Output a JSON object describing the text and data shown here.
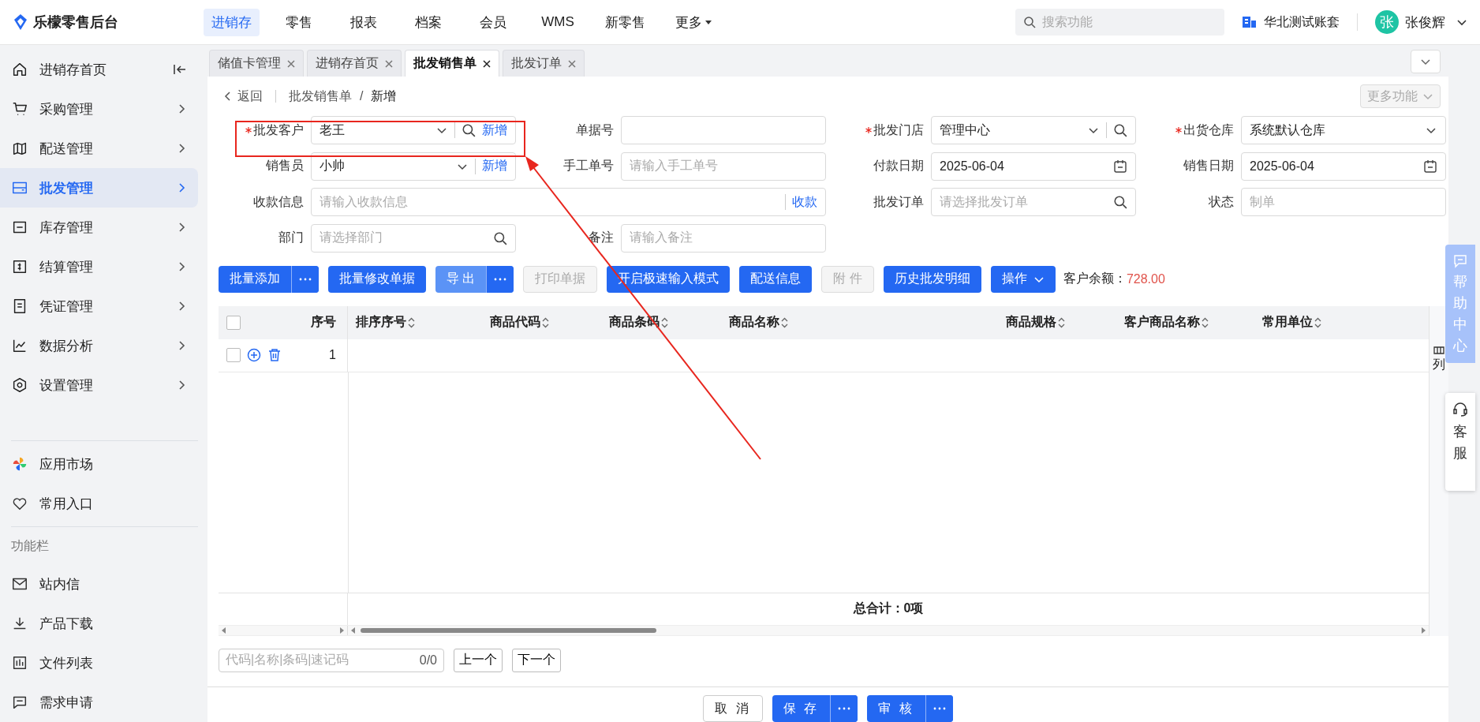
{
  "header": {
    "logo": "乐檬零售后台",
    "nav": [
      {
        "label": "进销存",
        "selected": true
      },
      {
        "label": "零售",
        "selected": false
      },
      {
        "label": "报表",
        "selected": false
      },
      {
        "label": "档案",
        "selected": false
      },
      {
        "label": "会员",
        "selected": false
      },
      {
        "label": "WMS",
        "selected": false
      },
      {
        "label": "新零售",
        "selected": false
      }
    ],
    "more": "更多",
    "search": {
      "placeholder": "搜索功能"
    },
    "account": "华北测试账套",
    "avatar": "张",
    "user": "张俊辉"
  },
  "sidebar": {
    "items": [
      {
        "label": "进销存首页",
        "selected": false
      },
      {
        "label": "采购管理",
        "selected": false
      },
      {
        "label": "配送管理",
        "selected": false
      },
      {
        "label": "批发管理",
        "selected": true
      },
      {
        "label": "库存管理",
        "selected": false
      },
      {
        "label": "结算管理",
        "selected": false
      },
      {
        "label": "凭证管理",
        "selected": false
      },
      {
        "label": "数据分析",
        "selected": false
      },
      {
        "label": "设置管理",
        "selected": false
      }
    ],
    "extras": [
      "应用市场",
      "常用入口"
    ],
    "section": "功能栏",
    "tools": [
      "站内信",
      "产品下载",
      "文件列表",
      "需求申请"
    ]
  },
  "tabs": [
    {
      "label": "储值卡管理",
      "selected": false
    },
    {
      "label": "进销存首页",
      "selected": false
    },
    {
      "label": "批发销售单",
      "selected": true
    },
    {
      "label": "批发订单",
      "selected": false
    }
  ],
  "breadcrumb": {
    "back": "返回",
    "path": "批发销售单",
    "separator": "/",
    "current": "新增",
    "more_button": "更多功能"
  },
  "form": [
    {
      "label": "批发客户",
      "required": true,
      "kind": "select-search-link",
      "value": "老王",
      "link": "新增"
    },
    {
      "label": "单据号",
      "required": false,
      "kind": "text"
    },
    {
      "label": "批发门店",
      "required": true,
      "kind": "select-search",
      "value": "管理中心"
    },
    {
      "label": "出货仓库",
      "required": true,
      "kind": "select",
      "value": "系统默认仓库"
    },
    {
      "label": "销售员",
      "required": false,
      "kind": "select-link",
      "value": "小帅",
      "link": "新增"
    },
    {
      "label": "手工单号",
      "required": false,
      "kind": "text",
      "placeholder": "请输入手工单号"
    },
    {
      "label": "付款日期",
      "required": false,
      "kind": "date",
      "value": "2025-06-04"
    },
    {
      "label": "销售日期",
      "required": false,
      "kind": "date",
      "value": "2025-06-04"
    },
    {
      "label": "收款信息",
      "required": false,
      "kind": "text-link",
      "wide": true,
      "placeholder": "请输入收款信息",
      "link": "收款"
    },
    {
      "label": "批发订单",
      "required": false,
      "kind": "search",
      "placeholder": "请选择批发订单"
    },
    {
      "label": "状态",
      "required": false,
      "kind": "text",
      "placeholder": "制单"
    },
    {
      "label": "部门",
      "required": false,
      "kind": "search",
      "placeholder": "请选择部门"
    },
    {
      "label": "备注",
      "required": false,
      "kind": "text",
      "placeholder": "请输入备注"
    }
  ],
  "toolbar": [
    {
      "label": "批量添加",
      "kind": "primary",
      "split": true
    },
    {
      "label": "批量修改单据",
      "kind": "primary",
      "split": false
    },
    {
      "label": "导 出",
      "kind": "light",
      "split": true
    },
    {
      "label": "打印单据",
      "kind": "disabled",
      "split": false
    },
    {
      "label": "开启极速输入模式",
      "kind": "primary",
      "split": false
    },
    {
      "label": "配送信息",
      "kind": "primary",
      "split": false
    },
    {
      "label": "附 件",
      "kind": "disabled",
      "split": false
    },
    {
      "label": "历史批发明细",
      "kind": "primary",
      "split": false
    },
    {
      "label": "操作",
      "kind": "dropdown",
      "split": false
    }
  ],
  "balance": {
    "label": "客户余额：",
    "value": "728.00"
  },
  "table": {
    "select_all": false,
    "columns": [
      "序号",
      "排序序号",
      "商品代码",
      "商品条码",
      "商品名称",
      "商品规格",
      "客户商品名称",
      "常用单位"
    ],
    "rows": [
      {
        "checked": false,
        "index": "1"
      }
    ],
    "total": "总合计：0项",
    "settings": "列"
  },
  "finder": {
    "placeholder": "代码|名称|条码|速记码",
    "count": "0/0",
    "prev": "上一个",
    "next": "下一个"
  },
  "actions": [
    {
      "label": "取 消",
      "kind": "default",
      "split": false
    },
    {
      "label": "保 存",
      "kind": "primary",
      "split": true
    },
    {
      "label": "审 核",
      "kind": "primary",
      "split": true
    }
  ],
  "help": {
    "label": "帮助中心",
    "service": "客服"
  }
}
